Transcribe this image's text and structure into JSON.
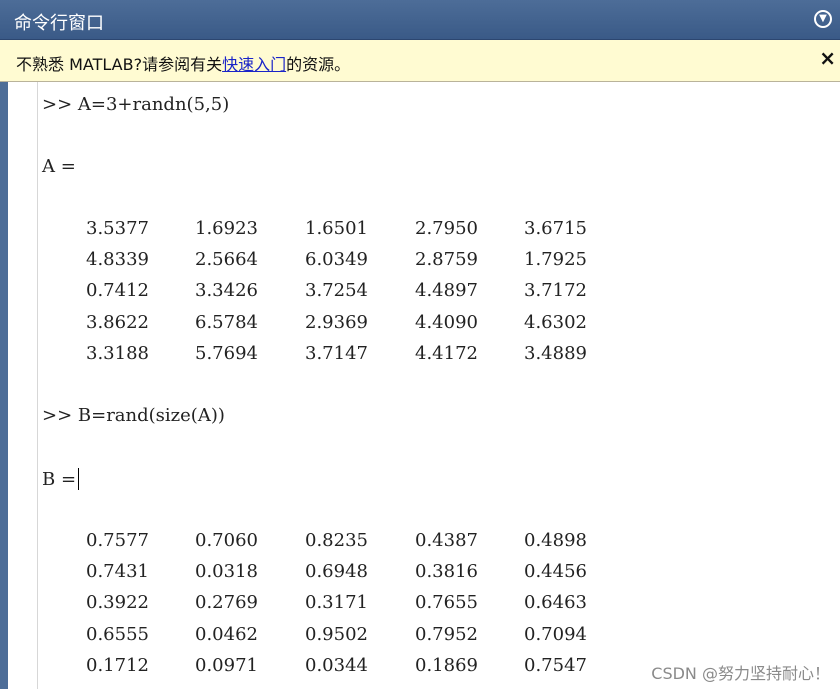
{
  "window": {
    "title": "命令行窗口",
    "menu_icon": "chevron-down-circle"
  },
  "infobar": {
    "prefix": "不熟悉 MATLAB?请参阅有关",
    "link": "快速入门",
    "suffix": "的资源。",
    "close_label": "×"
  },
  "console": {
    "cmd1": ">> A=3+randn(5,5)",
    "var1": "A =",
    "matrixA": [
      [
        "3.5377",
        "1.6923",
        "1.6501",
        "2.7950",
        "3.6715"
      ],
      [
        "4.8339",
        "2.5664",
        "6.0349",
        "2.8759",
        "1.7925"
      ],
      [
        "0.7412",
        "3.3426",
        "3.7254",
        "4.4897",
        "3.7172"
      ],
      [
        "3.8622",
        "6.5784",
        "2.9369",
        "4.4090",
        "4.6302"
      ],
      [
        "3.3188",
        "5.7694",
        "3.7147",
        "4.4172",
        "3.4889"
      ]
    ],
    "cmd2": ">> B=rand(size(A))",
    "var2": "B =",
    "matrixB": [
      [
        "0.7577",
        "0.7060",
        "0.8235",
        "0.4387",
        "0.4898"
      ],
      [
        "0.7431",
        "0.0318",
        "0.6948",
        "0.3816",
        "0.4456"
      ],
      [
        "0.3922",
        "0.2769",
        "0.3171",
        "0.7655",
        "0.6463"
      ],
      [
        "0.6555",
        "0.0462",
        "0.9502",
        "0.7952",
        "0.7094"
      ],
      [
        "0.1712",
        "0.0971",
        "0.0344",
        "0.1869",
        "0.7547"
      ]
    ]
  },
  "watermark": "CSDN @努力坚持耐心！"
}
